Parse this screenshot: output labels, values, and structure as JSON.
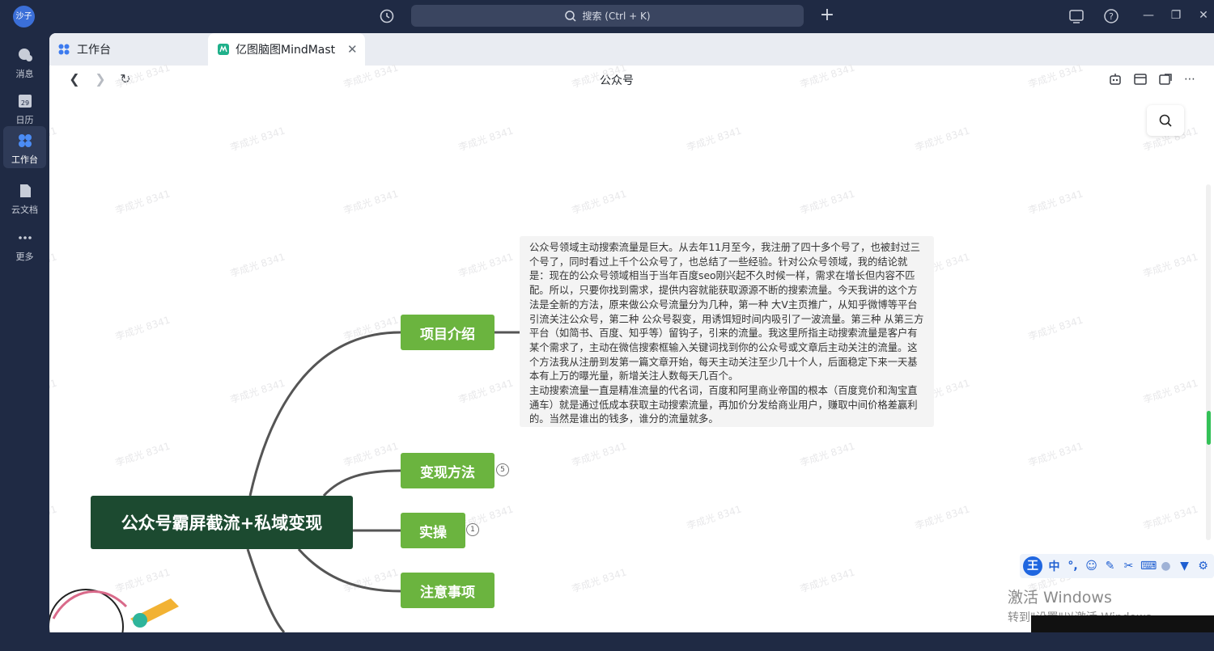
{
  "app": {
    "avatar_label": "沙子"
  },
  "search": {
    "placeholder": "搜索 (Ctrl + K)"
  },
  "rail": {
    "items": [
      {
        "label": "消息",
        "icon": "message-icon"
      },
      {
        "label": "日历",
        "icon": "calendar-icon",
        "date": "29"
      },
      {
        "label": "工作台",
        "icon": "workbench-icon"
      },
      {
        "label": "云文档",
        "icon": "cloud-doc-icon"
      },
      {
        "label": "更多",
        "icon": "more-icon"
      }
    ]
  },
  "tabs": [
    {
      "label": "工作台"
    },
    {
      "label": "亿图脑图MindMaster"
    }
  ],
  "page": {
    "title": "公众号"
  },
  "watermark": "李成光 8341",
  "mindmap": {
    "root": "公众号霸屏截流+私域变现",
    "branches": [
      {
        "label": "项目介绍"
      },
      {
        "label": "变现方法",
        "badge": "5"
      },
      {
        "label": "实操",
        "badge": "1"
      },
      {
        "label": "注意事项"
      }
    ],
    "note": "公众号领域主动搜索流量是巨大。从去年11月至今，我注册了四十多个号了，也被封过三个号了，同时看过上千个公众号了，也总结了一些经验。针对公众号领域，我的结论就是：现在的公众号领域相当于当年百度seo刚兴起不久时候一样，需求在增长但内容不匹配。所以，只要你找到需求，提供内容就能获取源源不断的搜索流量。今天我讲的这个方法是全新的方法，原来做公众号流量分为几种，第一种 大V主页推广，从知乎微博等平台引流关注公众号，第二种 公众号裂变，用诱饵短时间内吸引了一波流量。第三种 从第三方平台（如简书、百度、知乎等）留钩子，引来的流量。我这里所指主动搜索流量是客户有某个需求了，主动在微信搜索框输入关键词找到你的公众号或文章后主动关注的流量。这个方法我从注册到发第一篇文章开始，每天主动关注至少几十个人，后面稳定下来一天基本有上万的曝光量，新增关注人数每天几百个。\n主动搜索流量一直是精准流量的代名词，百度和阿里商业帝国的根本（百度竞价和淘宝直通车）就是通过低成本获取主动搜索流量，再加价分发给商业用户，赚取中间价格差赢利的。当然是谁出的钱多，谁分的流量就多。"
  },
  "ime": {
    "logo": "王",
    "mode": "中"
  },
  "os_notice": {
    "line1": "激活 Windows",
    "line2": "转到\"设置\"以激活 Windows。"
  },
  "colors": {
    "root_bg": "#1c4a30",
    "branch_bg": "#6bb43f",
    "sidebar_bg": "#1f2a44"
  }
}
